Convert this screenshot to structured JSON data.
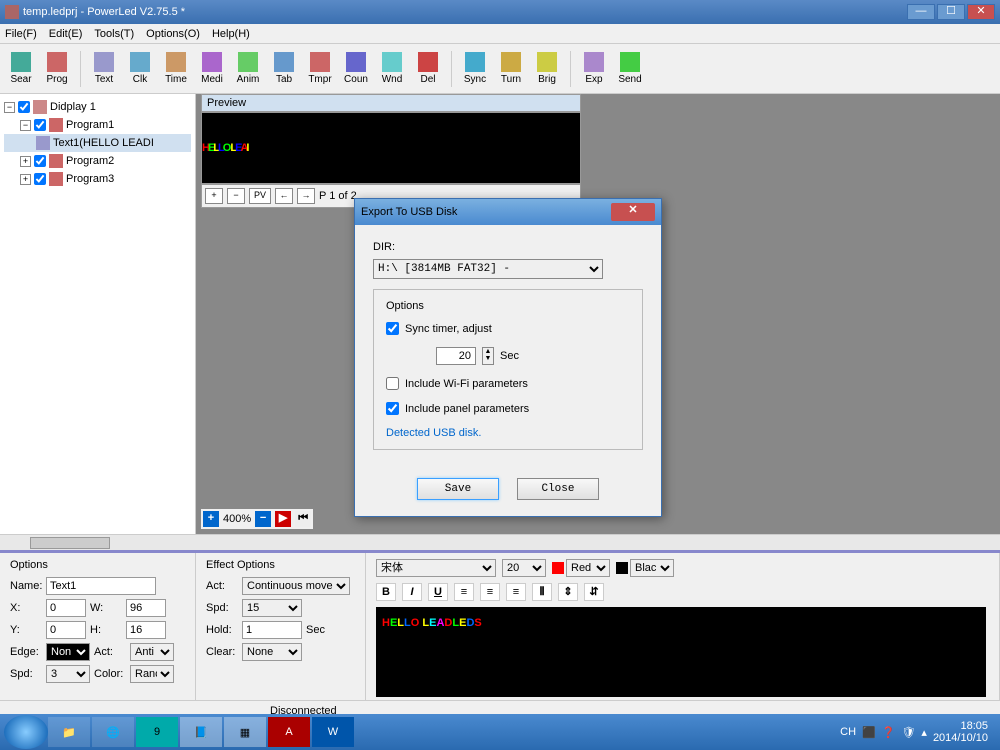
{
  "title": "temp.ledprj - PowerLed V2.75.5 *",
  "menus": [
    "File(F)",
    "Edit(E)",
    "Tools(T)",
    "Options(O)",
    "Help(H)"
  ],
  "toolbar": [
    {
      "label": "Sear",
      "icon": "search"
    },
    {
      "label": "Prog",
      "icon": "prog"
    },
    {
      "sep": true
    },
    {
      "label": "Text",
      "icon": "text"
    },
    {
      "label": "Clk",
      "icon": "clock"
    },
    {
      "label": "Time",
      "icon": "time"
    },
    {
      "label": "Medi",
      "icon": "media"
    },
    {
      "label": "Anim",
      "icon": "anim"
    },
    {
      "label": "Tab",
      "icon": "table"
    },
    {
      "label": "Tmpr",
      "icon": "temp"
    },
    {
      "label": "Coun",
      "icon": "count"
    },
    {
      "label": "Wnd",
      "icon": "window"
    },
    {
      "label": "Del",
      "icon": "delete"
    },
    {
      "sep": true
    },
    {
      "label": "Sync",
      "icon": "sync"
    },
    {
      "label": "Turn",
      "icon": "turn"
    },
    {
      "label": "Brig",
      "icon": "bright"
    },
    {
      "sep": true
    },
    {
      "label": "Exp",
      "icon": "export"
    },
    {
      "label": "Send",
      "icon": "send"
    }
  ],
  "tree": {
    "root": "Didplay 1",
    "items": [
      "Program1",
      "Text1(HELLO LEADI",
      "Program2",
      "Program3"
    ]
  },
  "preview": {
    "title": "Preview",
    "text": "HELLO LEAI",
    "page": "P 1 of 2",
    "zoom": "400%"
  },
  "dialog": {
    "title": "Export To USB Disk",
    "dir_label": "DIR:",
    "dir_value": "H:\\ [3814MB FAT32] -",
    "options_label": "Options",
    "sync_label": "Sync timer, adjust",
    "sync_value": "20",
    "sync_unit": "Sec",
    "wifi_label": "Include Wi-Fi parameters",
    "panel_label": "Include panel parameters",
    "detected": "Detected USB disk.",
    "save": "Save",
    "close": "Close"
  },
  "options": {
    "title": "Options",
    "name_label": "Name:",
    "name": "Text1",
    "x_label": "X:",
    "x": "0",
    "w_label": "W:",
    "w": "96",
    "y_label": "Y:",
    "y": "0",
    "h_label": "H:",
    "h": "16",
    "edge_label": "Edge:",
    "edge": "Non",
    "act2_label": "Act:",
    "act2": "Anti",
    "spd2_label": "Spd:",
    "spd2": "3",
    "color_label": "Color:",
    "color": "Ranc"
  },
  "effect": {
    "title": "Effect Options",
    "act_label": "Act:",
    "act": "Continuous move",
    "spd_label": "Spd:",
    "spd": "15",
    "hold_label": "Hold:",
    "hold": "1",
    "hold_unit": "Sec",
    "clear_label": "Clear:",
    "clear": "None"
  },
  "format": {
    "font": "宋体",
    "size": "20",
    "fgcolor": "Red",
    "bgcolor": "Blac",
    "editor_text": "HELLO LEADLEDS"
  },
  "status": "Disconnected",
  "tray": {
    "lang": "CH",
    "time": "18:05",
    "date": "2014/10/10"
  }
}
